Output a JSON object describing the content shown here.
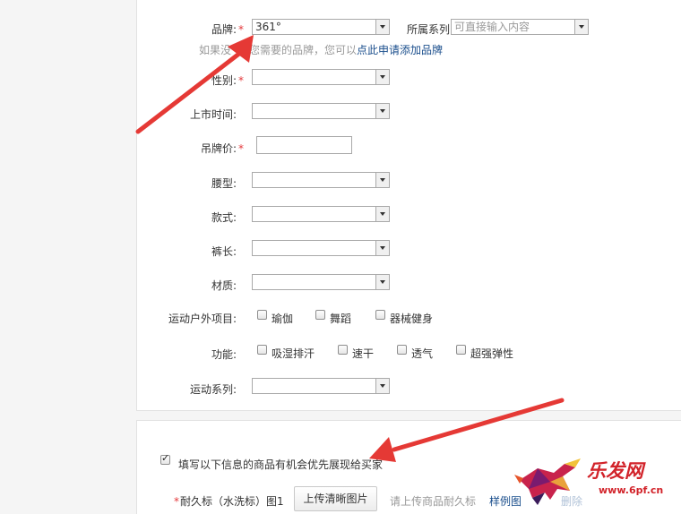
{
  "form": {
    "brand": {
      "label": "品牌:",
      "value": "361°"
    },
    "series": {
      "label": "所属系列",
      "placeholder": "可直接输入内容"
    },
    "brand_hint": {
      "text_a": "如果没",
      "text_b": "您需要的品牌，您可以",
      "link": "点此申请添加品牌"
    },
    "gender": {
      "label": "性别:"
    },
    "launch": {
      "label": "上市时间:"
    },
    "price": {
      "label": "吊牌价:"
    },
    "waist": {
      "label": "腰型:"
    },
    "style": {
      "label": "款式:"
    },
    "length": {
      "label": "裤长:"
    },
    "material": {
      "label": "材质:"
    },
    "sports": {
      "label": "运动户外项目:",
      "options": [
        "瑜伽",
        "舞蹈",
        "器械健身"
      ]
    },
    "function": {
      "label": "功能:",
      "options": [
        "吸湿排汗",
        "速干",
        "透气",
        "超强弹性"
      ]
    },
    "sport_series": {
      "label": "运动系列:"
    },
    "required_mark": "*"
  },
  "section2": {
    "checkbox_label": "填写以下信息的商品有机会优先展现给买家",
    "checked": true,
    "label_tag": "耐久标（水洗标）图1",
    "upload_button": "上传清晰图片",
    "upload_hint": "请上传商品耐久标",
    "sample_link": "样例图",
    "obscured_text": "删除"
  },
  "watermark": {
    "brand": "乐发网",
    "url": "www.6pf.cn"
  },
  "colors": {
    "arrow": "#e53935",
    "link": "#1a4e8c",
    "required": "#e4393c",
    "watermark_red": "#d2232a"
  }
}
